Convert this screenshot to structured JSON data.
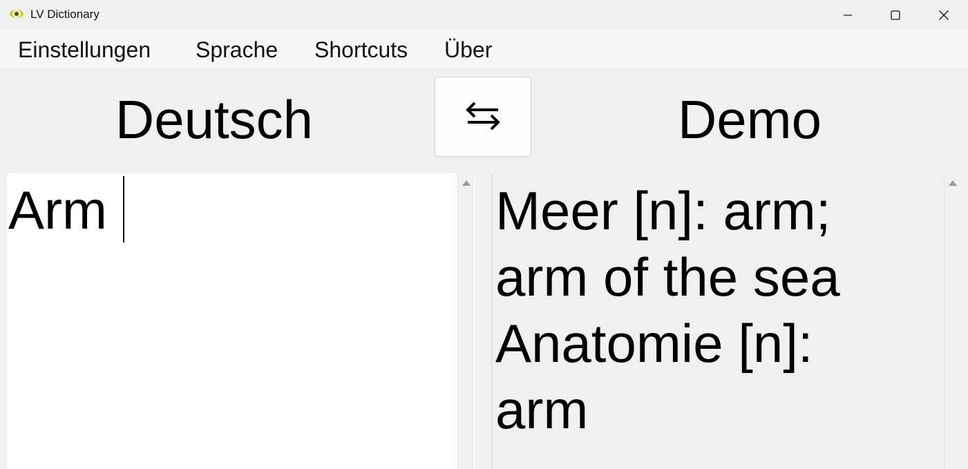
{
  "window": {
    "title": "LV Dictionary",
    "icon": "eye-icon"
  },
  "menu": {
    "items": [
      {
        "label": "Einstellungen"
      },
      {
        "label": "Sprache"
      },
      {
        "label": "Shortcuts"
      },
      {
        "label": "Über"
      }
    ]
  },
  "languages": {
    "source": "Deutsch",
    "target": "Demo",
    "swap_icon": "swap-arrows-icon"
  },
  "input": {
    "value": "Arm"
  },
  "output": {
    "lines": [
      "Meer [n]: arm;",
      "arm of the sea",
      "Anatomie [n]:",
      "arm"
    ]
  },
  "colors": {
    "icon_yellow": "#c8d400",
    "background": "#f0f0f0",
    "menubar": "#f7f7f7"
  }
}
